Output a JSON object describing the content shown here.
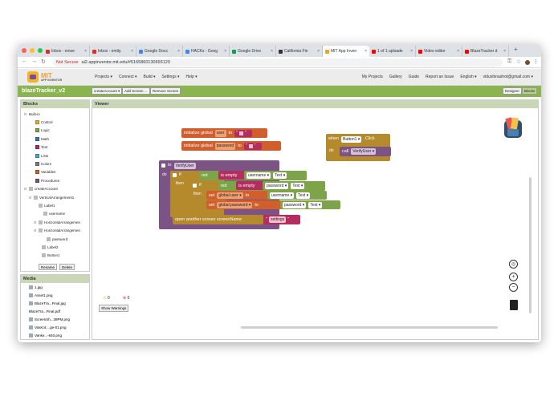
{
  "browser": {
    "tabs": [
      {
        "label": "Inbox - emse",
        "color": "#d93025"
      },
      {
        "label": "Inbox - emily.",
        "color": "#d93025"
      },
      {
        "label": "Google Docs",
        "color": "#4285f4"
      },
      {
        "label": "HACKs - Goog",
        "color": "#4285f4"
      },
      {
        "label": "Google Drive",
        "color": "#0f9d58"
      },
      {
        "label": "California Fin",
        "color": "#333333"
      },
      {
        "label": "MIT App Inven",
        "color": "#f0a02c"
      },
      {
        "label": "1 of 1 uploade",
        "color": "#ff0000"
      },
      {
        "label": "Video editor",
        "color": "#ff0000"
      },
      {
        "label": "BlazeTracker d",
        "color": "#ff0000"
      }
    ],
    "not_secure": "Not Secure",
    "url": "ai2.appinventor.mit.edu/#5165860130693120"
  },
  "app": {
    "logo_title": "MIT",
    "logo_subtitle": "APP INVENTOR",
    "menu": [
      "Projects ▾",
      "Connect ▾",
      "Build ▾",
      "Settings ▾",
      "Help ▾"
    ],
    "menu_right": [
      "My Projects",
      "Gallery",
      "Guide",
      "Report an Issue",
      "English ▾",
      "vidushinashot@gmail.com ▾"
    ]
  },
  "project": {
    "name": "blazeTracker_v2",
    "screen_dropdown": "createAccount ▾",
    "add_screen": "Add Screen ...",
    "remove_screen": "Remove Screen",
    "designer": "Designer",
    "blocks": "Blocks"
  },
  "blocks_panel": {
    "title": "Blocks",
    "builtin": "Built-in",
    "builtins": [
      {
        "label": "Control",
        "color": "#e5a93b"
      },
      {
        "label": "Logic",
        "color": "#7ea449"
      },
      {
        "label": "Math",
        "color": "#3f71b5"
      },
      {
        "label": "Text",
        "color": "#b32d5e"
      },
      {
        "label": "Lists",
        "color": "#49a6d4"
      },
      {
        "label": "Colors",
        "color": "#7d7d7d"
      },
      {
        "label": "Variables",
        "color": "#d05f2d"
      },
      {
        "label": "Procedures",
        "color": "#7c5385"
      }
    ],
    "components": [
      "createAccount",
      "VerticalArrangement1",
      "Label1",
      "username",
      "HorizontalArrangemen",
      "HorizontalArrangemen",
      "password",
      "Label2",
      "Button1"
    ],
    "rename": "Rename",
    "delete": "Delete"
  },
  "media_panel": {
    "title": "Media",
    "items": [
      "1.jpg",
      "Asset1.png",
      "BlazeTra...Final.jpg",
      "BlazeTra...Final.pdf",
      "ScreenSh...39PM.png",
      "VasKot....ge-01.png",
      "Vanke...-640.png"
    ]
  },
  "viewer": {
    "title": "Viewer",
    "blocks": {
      "init_user": "initialize global",
      "user_name": "user",
      "to": "to",
      "init_password": "initialize global",
      "password_name": "password",
      "when": "when",
      "button1": "Button1 ▾",
      "click": ".Click",
      "do": "do",
      "call": "call",
      "verify_user": "VerifyUser ▾",
      "to_proc": "to",
      "proc_name": "VerifyUser",
      "if": "if",
      "not": "not",
      "is_empty": "is empty",
      "username": "username ▾",
      "text": "Text ▾",
      "password": "password ▾",
      "then": "then",
      "set": "set",
      "global_user": "global user ▾",
      "global_password": "global password ▾",
      "open_screen": "open another screen screenName",
      "settings": "settings"
    },
    "warnings": {
      "count_warn": "0",
      "count_err": "0",
      "show_warnings": "Show Warnings"
    }
  }
}
